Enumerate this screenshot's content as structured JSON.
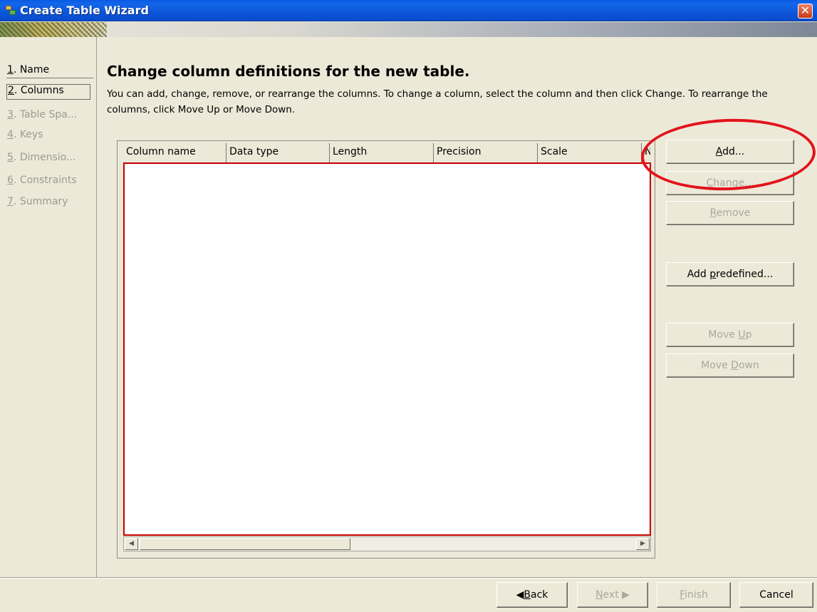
{
  "window": {
    "title": "Create Table Wizard",
    "close_glyph": "✕"
  },
  "nav": {
    "items": [
      {
        "num": "1",
        "label": ". Name",
        "state": "enabled"
      },
      {
        "num": "2",
        "label": ". Columns",
        "state": "active"
      },
      {
        "num": "3",
        "label": ". Table Spa...",
        "state": "disabled"
      },
      {
        "num": "4",
        "label": ". Keys",
        "state": "disabled"
      },
      {
        "num": "5",
        "label": ". Dimensio...",
        "state": "disabled"
      },
      {
        "num": "6",
        "label": ". Constraints",
        "state": "disabled"
      },
      {
        "num": "7",
        "label": ". Summary",
        "state": "disabled"
      }
    ]
  },
  "content": {
    "heading": "Change column definitions for the new table.",
    "description": "You can add, change, remove, or rearrange the columns. To change a column, select the column and then click Change. To rearrange the columns, click Move Up or Move Down."
  },
  "table": {
    "columns": [
      "Column name",
      "Data type",
      "Length",
      "Precision",
      "Scale",
      "N"
    ],
    "rows": []
  },
  "buttons": {
    "add": {
      "pre": "",
      "u": "A",
      "post": "dd..."
    },
    "change": {
      "pre": "",
      "u": "C",
      "post": "hange..."
    },
    "remove": {
      "pre": "",
      "u": "R",
      "post": "emove"
    },
    "add_predefined": {
      "pre": "Add ",
      "u": "p",
      "post": "redefined..."
    },
    "move_up": {
      "pre": "Move ",
      "u": "U",
      "post": "p"
    },
    "move_down": {
      "pre": "Move ",
      "u": "D",
      "post": "own"
    }
  },
  "footer": {
    "back": {
      "arrow": "◀",
      "u": "B",
      "post": "ack"
    },
    "next": {
      "u": "N",
      "post": "ext",
      "arrow": "▶"
    },
    "finish": {
      "u": "F",
      "post": "inish"
    },
    "cancel": "Cancel"
  },
  "colors": {
    "annotation": "#e3131b",
    "title_bar": "#0a5be3",
    "table_border": "#c40000"
  }
}
